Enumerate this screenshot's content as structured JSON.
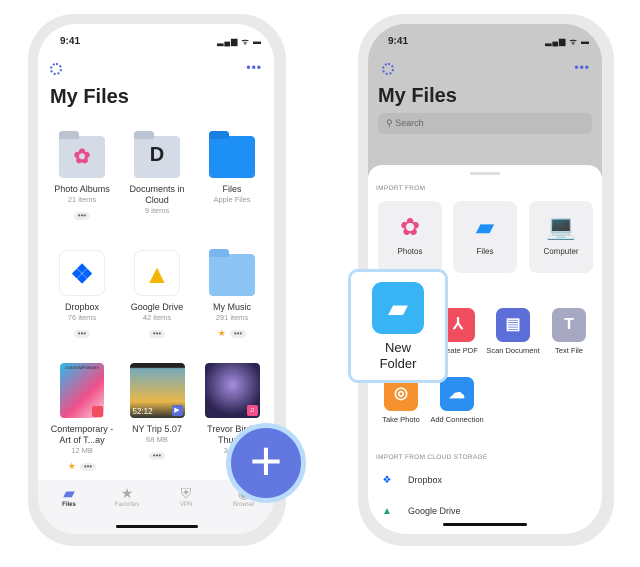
{
  "status": {
    "time": "9:41",
    "indicators": "▂▄▆ ᯤ ▬"
  },
  "left": {
    "title": "My Files",
    "more": "•••",
    "items": [
      {
        "name": "Photo Albums",
        "sub": "21 items",
        "icon": "photos-folder-icon",
        "glyph": "✿"
      },
      {
        "name": "Documents in Cloud",
        "sub": "9 items",
        "icon": "documents-folder-icon",
        "glyph": "D"
      },
      {
        "name": "Files",
        "sub": "Apple Files",
        "icon": "apple-files-folder-icon",
        "glyph": ""
      },
      {
        "name": "Dropbox",
        "sub": "76 items",
        "icon": "dropbox-icon",
        "glyph": "❖"
      },
      {
        "name": "Google Drive",
        "sub": "42 items",
        "icon": "google-drive-icon",
        "glyph": "▲"
      },
      {
        "name": "My Music",
        "sub": "291 items",
        "icon": "music-folder-icon",
        "glyph": "",
        "starred": true
      },
      {
        "name": "Contemporary - Art of T...ay",
        "sub": "12 MB",
        "icon": "pdf-thumbnail",
        "starred": true,
        "thumb_text": "CONTEMPORARY"
      },
      {
        "name": "NY Trip 5.07",
        "sub": "68 MB",
        "icon": "video-thumbnail",
        "duration": "52:12"
      },
      {
        "name": "Trevor Bird - Thun...",
        "sub": "3,7...",
        "icon": "music-thumbnail"
      }
    ],
    "dots": "•••",
    "star": "★",
    "tabs": [
      {
        "label": "Files",
        "icon": "folder-icon",
        "glyph": "▰"
      },
      {
        "label": "Favorites",
        "icon": "star-icon",
        "glyph": "★"
      },
      {
        "label": "VPN",
        "icon": "shield-icon",
        "glyph": "⛨"
      },
      {
        "label": "Browser",
        "icon": "compass-icon",
        "glyph": "◉"
      }
    ],
    "fab": "+"
  },
  "right": {
    "title": "My Files",
    "search_placeholder": "Search",
    "import_from": "IMPORT FROM",
    "tiles": [
      {
        "label": "Photos",
        "glyph": "✿"
      },
      {
        "label": "Files",
        "glyph": "▰"
      },
      {
        "label": "Computer",
        "glyph": "💻"
      }
    ],
    "actions": [
      {
        "label": "Create PDF",
        "glyph": "⅄",
        "color": "#f04e5e"
      },
      {
        "label": "Scan Document",
        "glyph": "▤",
        "color": "#5c6fd8"
      },
      {
        "label": "Text File",
        "glyph": "T",
        "color": "#a7a9c2"
      },
      {
        "label": "Take Photo",
        "glyph": "◎",
        "color": "#f5922f"
      },
      {
        "label": "Add Connection",
        "glyph": "☁",
        "color": "#2a8ff0"
      }
    ],
    "new_folder": "New Folder",
    "cloud_title": "IMPORT FROM CLOUD STORAGE",
    "cloud": [
      {
        "label": "Dropbox",
        "glyph": "❖",
        "color": "#0061fe"
      },
      {
        "label": "Google Drive",
        "glyph": "▲",
        "color": "#1fa463"
      }
    ]
  },
  "colors": {
    "accent": "#5566dd",
    "fab": "#6277e0"
  }
}
